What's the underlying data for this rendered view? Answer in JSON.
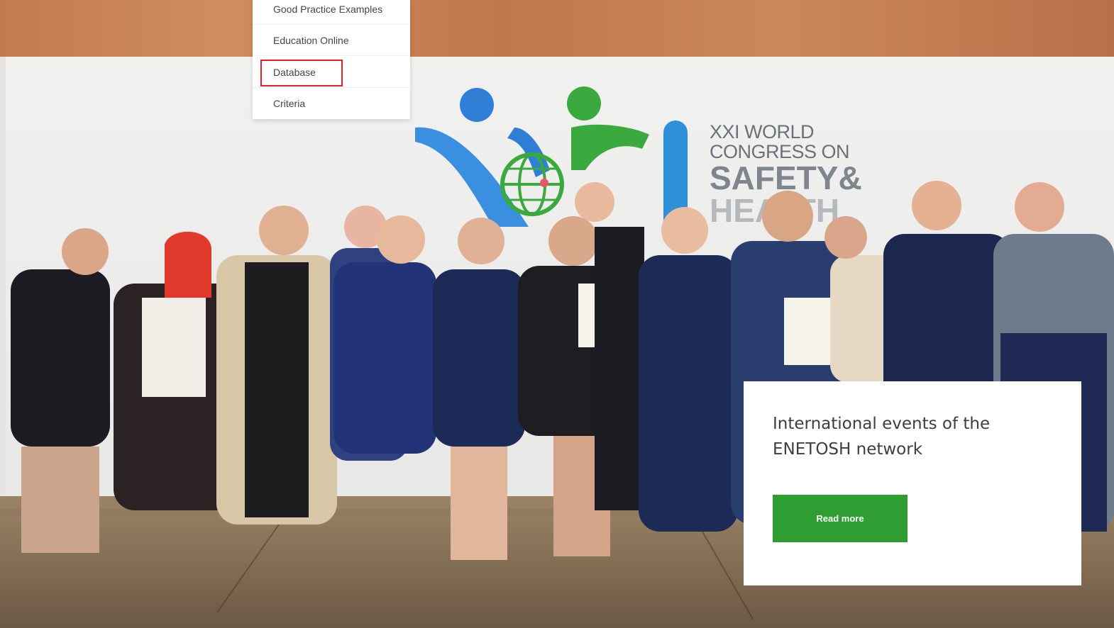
{
  "menu": {
    "items": [
      {
        "label": "Good Practice Examples"
      },
      {
        "label": "Education Online"
      },
      {
        "label": "Database",
        "highlighted": true
      },
      {
        "label": "Criteria"
      }
    ],
    "highlight_color": "#e52027"
  },
  "backdrop": {
    "line1": "XXI WORLD",
    "line2": "CONGRESS ON",
    "line3": "SAFETY&",
    "line4": "HEALTH"
  },
  "card": {
    "title": "International events of the ENETOSH network",
    "button_label": "Read more",
    "button_color": "#2e9e32"
  },
  "photo": {
    "subject": "Group photo of award winners on stage"
  }
}
